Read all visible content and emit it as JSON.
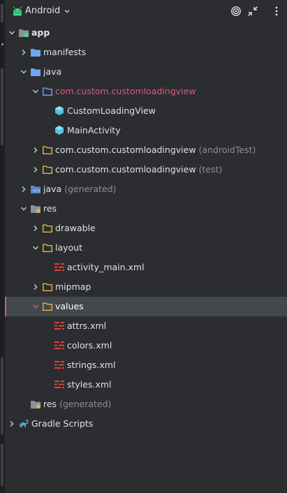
{
  "header": {
    "title": "Android",
    "icons": [
      "android-icon",
      "chevron-down-icon",
      "locate-icon",
      "collapse-all-icon",
      "more-options-icon"
    ]
  },
  "tree": [
    {
      "label": "app",
      "suffix": "",
      "icon": "module-folder-icon",
      "expanded": true
    },
    {
      "label": "manifests",
      "suffix": "",
      "icon": "folder-icon",
      "expanded": false
    },
    {
      "label": "java",
      "suffix": "",
      "icon": "folder-icon",
      "expanded": true
    },
    {
      "label": "com.custom.customloadingview",
      "suffix": "",
      "icon": "package-icon",
      "expanded": true,
      "color": "#e0577e"
    },
    {
      "label": "CustomLoadingView",
      "suffix": "",
      "icon": "class-icon"
    },
    {
      "label": "MainActivity",
      "suffix": "",
      "icon": "class-icon"
    },
    {
      "label": "com.custom.customloadingview",
      "suffix": "(androidTest)",
      "icon": "package-icon",
      "expanded": false
    },
    {
      "label": "com.custom.customloadingview",
      "suffix": "(test)",
      "icon": "package-icon",
      "expanded": false
    },
    {
      "label": "java",
      "suffix": "(generated)",
      "icon": "generated-folder-icon",
      "expanded": false
    },
    {
      "label": "res",
      "suffix": "",
      "icon": "res-folder-icon",
      "expanded": true
    },
    {
      "label": "drawable",
      "suffix": "",
      "icon": "package-icon",
      "expanded": false
    },
    {
      "label": "layout",
      "suffix": "",
      "icon": "package-icon",
      "expanded": true
    },
    {
      "label": "activity_main.xml",
      "suffix": "",
      "icon": "xml-file-icon"
    },
    {
      "label": "mipmap",
      "suffix": "",
      "icon": "package-icon",
      "expanded": false
    },
    {
      "label": "values",
      "suffix": "",
      "icon": "package-icon",
      "expanded": true,
      "selected": true
    },
    {
      "label": "attrs.xml",
      "suffix": "",
      "icon": "xml-file-icon"
    },
    {
      "label": "colors.xml",
      "suffix": "",
      "icon": "xml-file-icon"
    },
    {
      "label": "strings.xml",
      "suffix": "",
      "icon": "xml-file-icon"
    },
    {
      "label": "styles.xml",
      "suffix": "",
      "icon": "xml-file-icon"
    },
    {
      "label": "res",
      "suffix": "(generated)",
      "icon": "res-folder-icon"
    },
    {
      "label": "Gradle Scripts",
      "suffix": "",
      "icon": "gradle-icon",
      "expanded": false
    }
  ],
  "colors": {
    "background": "#2b2d30",
    "selection": "#43474e",
    "selection_accent": "#d85a7f",
    "folder_blue": "#6ea6f4",
    "package_yellow": "#e8b33f",
    "class_cyan": "#4fc4e8",
    "xml_red": "#e0433b",
    "highlight_text": "#e0577e",
    "dim_text": "#8c9099"
  }
}
